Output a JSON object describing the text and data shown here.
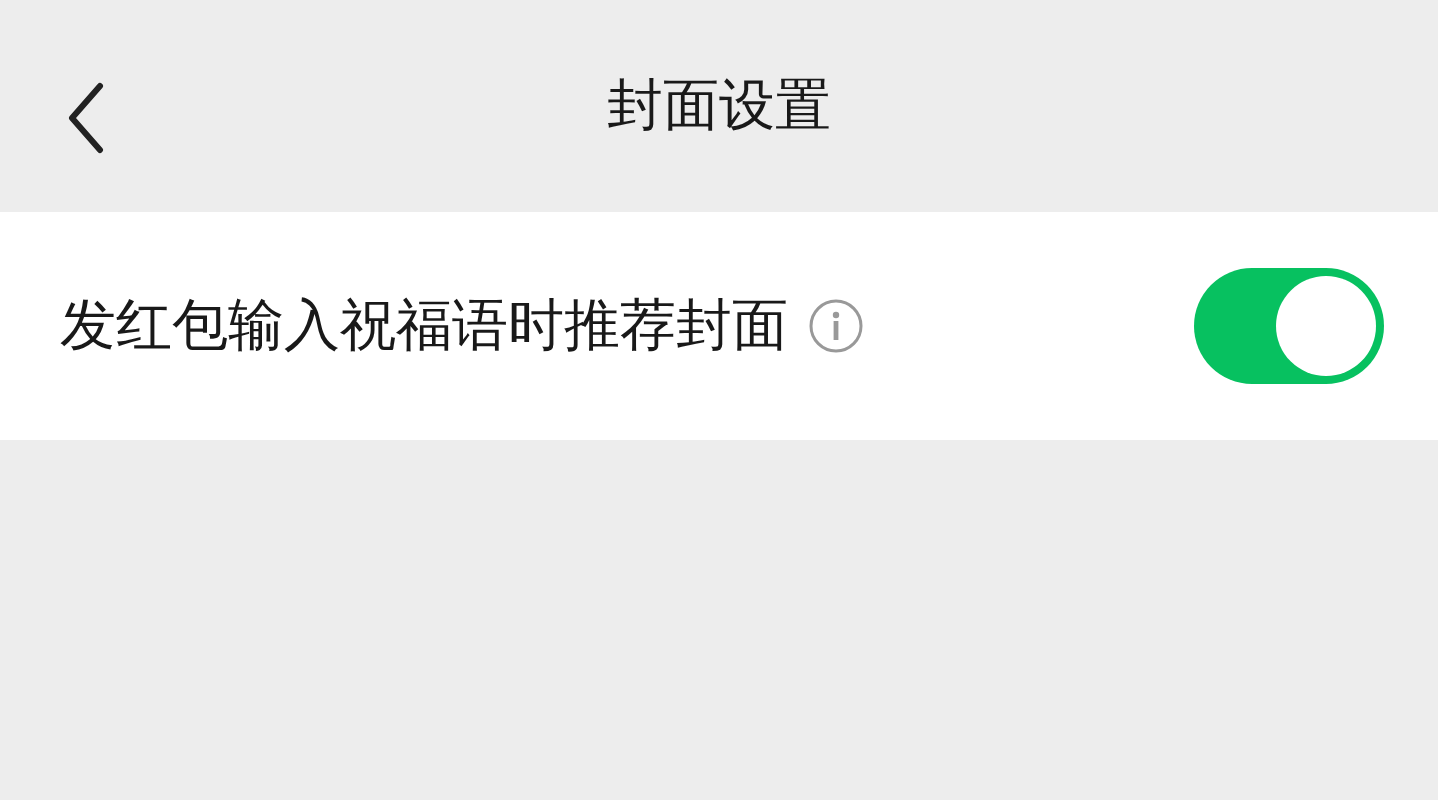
{
  "header": {
    "title": "封面设置"
  },
  "settings": [
    {
      "label": "发红包输入祝福语时推荐封面",
      "on": true
    }
  ]
}
